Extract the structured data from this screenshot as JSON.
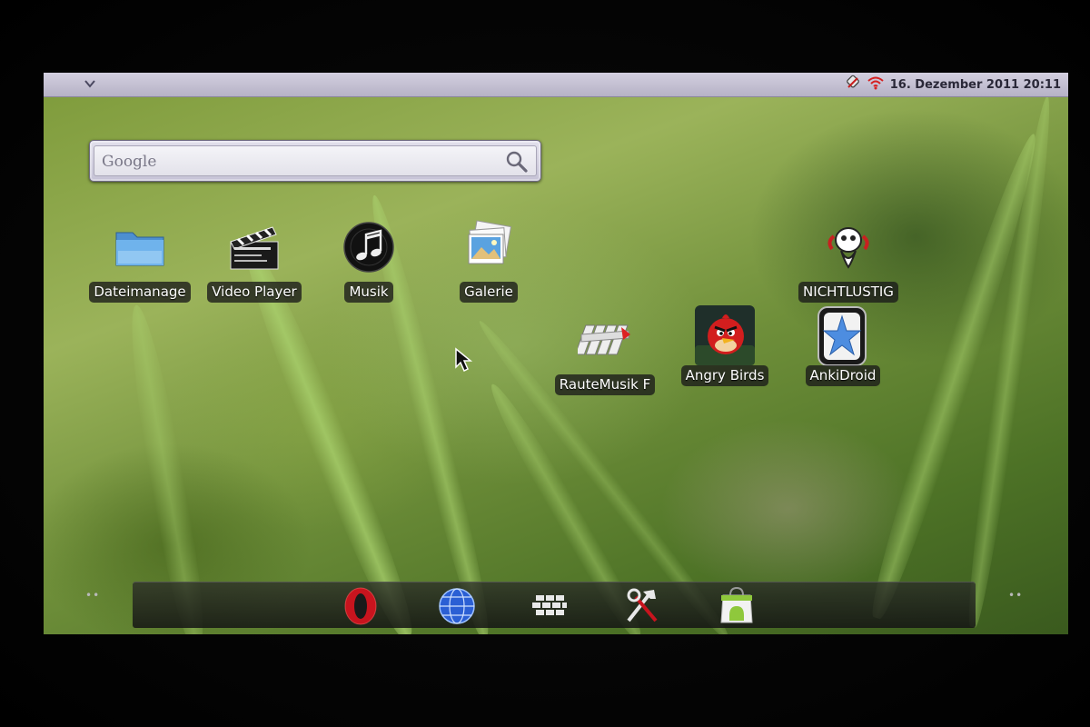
{
  "status_bar": {
    "datetime": "16. Dezember 2011 20:11",
    "icons": [
      "expand-chevron-icon",
      "usb-debug-icon",
      "wifi-icon"
    ]
  },
  "search": {
    "placeholder": "Google",
    "icon": "search-icon"
  },
  "apps": [
    {
      "label": "Dateimanage",
      "icon": "folder-icon"
    },
    {
      "label": "Video Player",
      "icon": "clapperboard-icon"
    },
    {
      "label": "Musik",
      "icon": "music-note-icon"
    },
    {
      "label": "Galerie",
      "icon": "photos-icon"
    },
    {
      "label": "NICHTLUSTIG",
      "icon": "cartoon-creature-icon"
    },
    {
      "label": "RauteMusik F",
      "icon": "rautemusik-logo-icon"
    },
    {
      "label": "Angry Birds",
      "icon": "angry-bird-icon"
    },
    {
      "label": "AnkiDroid",
      "icon": "star-card-icon"
    }
  ],
  "dock": [
    {
      "name": "opera-icon"
    },
    {
      "name": "browser-globe-icon"
    },
    {
      "name": "app-drawer-icon"
    },
    {
      "name": "tools-icon"
    },
    {
      "name": "android-market-icon"
    }
  ],
  "colors": {
    "status_bar": "#c6c2d6",
    "label_bg": "#191919",
    "opera_red": "#c8141e"
  }
}
